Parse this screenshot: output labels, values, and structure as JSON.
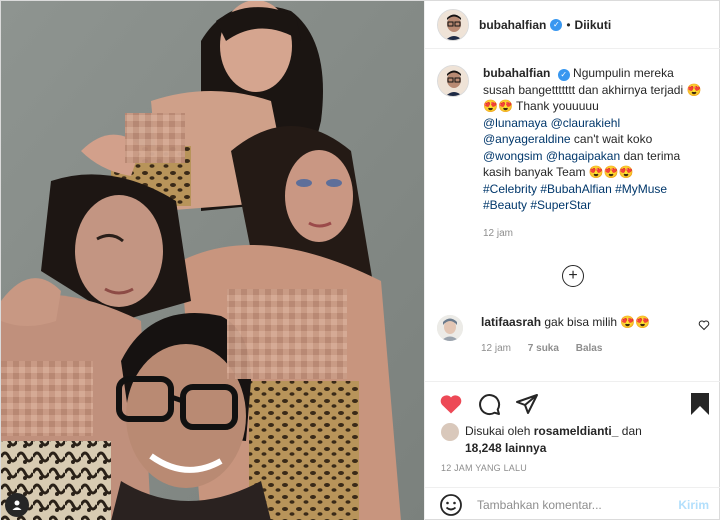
{
  "account": {
    "username": "bubahalfian",
    "verified": true,
    "separator": "•",
    "follow_status": "Diikuti"
  },
  "caption": {
    "username": "bubahalfian",
    "line1": "Ngumpulin mereka susah bangettttttt dan akhirnya terjadi",
    "emojis1": "😍😍😍",
    "line2": "Thank youuuuu",
    "mention1": "@lunamaya",
    "mention2": "@claurakiehl",
    "mention3": "@anyageraldine",
    "line3": "can't wait koko",
    "mention4": "@wongsim",
    "mention5": "@hagaipakan",
    "line4": "dan terima kasih banyak Team",
    "emojis2": "😍😍😍",
    "hashtags": "#Celebrity #BubahAlfian #MyMuse #Beauty #SuperStar",
    "time": "12 jam"
  },
  "more_comments_label": "+",
  "comment": {
    "username": "latifaasrah",
    "text": "gak bisa milih",
    "emojis": "😍😍",
    "time": "12 jam",
    "likes": "7 suka",
    "reply": "Balas"
  },
  "actions": {
    "like_icon": "heart-icon",
    "comment_icon": "comment-icon",
    "share_icon": "paper-plane-icon",
    "save_icon": "bookmark-icon",
    "like_color": "#ed4956"
  },
  "likes": {
    "prefix": "Disukai oleh",
    "user": "rosameldianti_",
    "conj": "dan",
    "count": "18,248 lainnya"
  },
  "posted": "12 JAM YANG LALU",
  "add_comment": {
    "placeholder": "Tambahkan komentar...",
    "send": "Kirim"
  },
  "colors": {
    "link": "#00376b",
    "muted": "#8e8e8e",
    "verified": "#3897f0",
    "send_disabled": "#b2dffc"
  }
}
